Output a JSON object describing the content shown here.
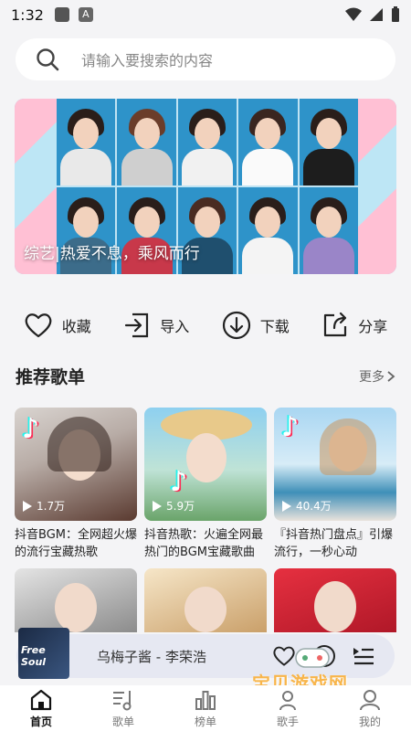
{
  "status_bar": {
    "time": "1:32",
    "notif_badge": "A"
  },
  "search": {
    "placeholder": "请输入要搜索的内容"
  },
  "banner": {
    "caption": "综艺|热爱不息，乘风而行"
  },
  "actions": [
    {
      "label": "收藏",
      "icon": "heart-icon"
    },
    {
      "label": "导入",
      "icon": "import-icon"
    },
    {
      "label": "下载",
      "icon": "download-icon"
    },
    {
      "label": "分享",
      "icon": "share-icon"
    }
  ],
  "section": {
    "title": "推荐歌单",
    "more": "更多"
  },
  "playlists": [
    {
      "plays": "1.7万",
      "title": "抖音BGM：全网超火爆的流行宝藏热歌"
    },
    {
      "plays": "5.9万",
      "title": "抖音热歌：火遍全网最热门的BGM宝藏歌曲"
    },
    {
      "plays": "40.4万",
      "title": "『抖音热门盘点』引爆流行，一秒心动"
    }
  ],
  "player": {
    "title": "乌梅子酱 - 李荣浩",
    "cover_text": "Free Soul"
  },
  "tabs": [
    {
      "label": "首页",
      "active": true
    },
    {
      "label": "歌单",
      "active": false
    },
    {
      "label": "榜单",
      "active": false
    },
    {
      "label": "歌手",
      "active": false
    },
    {
      "label": "我的",
      "active": false
    }
  ],
  "watermark": {
    "text": "宝贝游戏网",
    "url": "baobeiy.com"
  },
  "colors": {
    "accent": "#111111",
    "background": "#f4f4f6",
    "banner": "#2e93c9",
    "player_bg": "#e6e8f2"
  }
}
